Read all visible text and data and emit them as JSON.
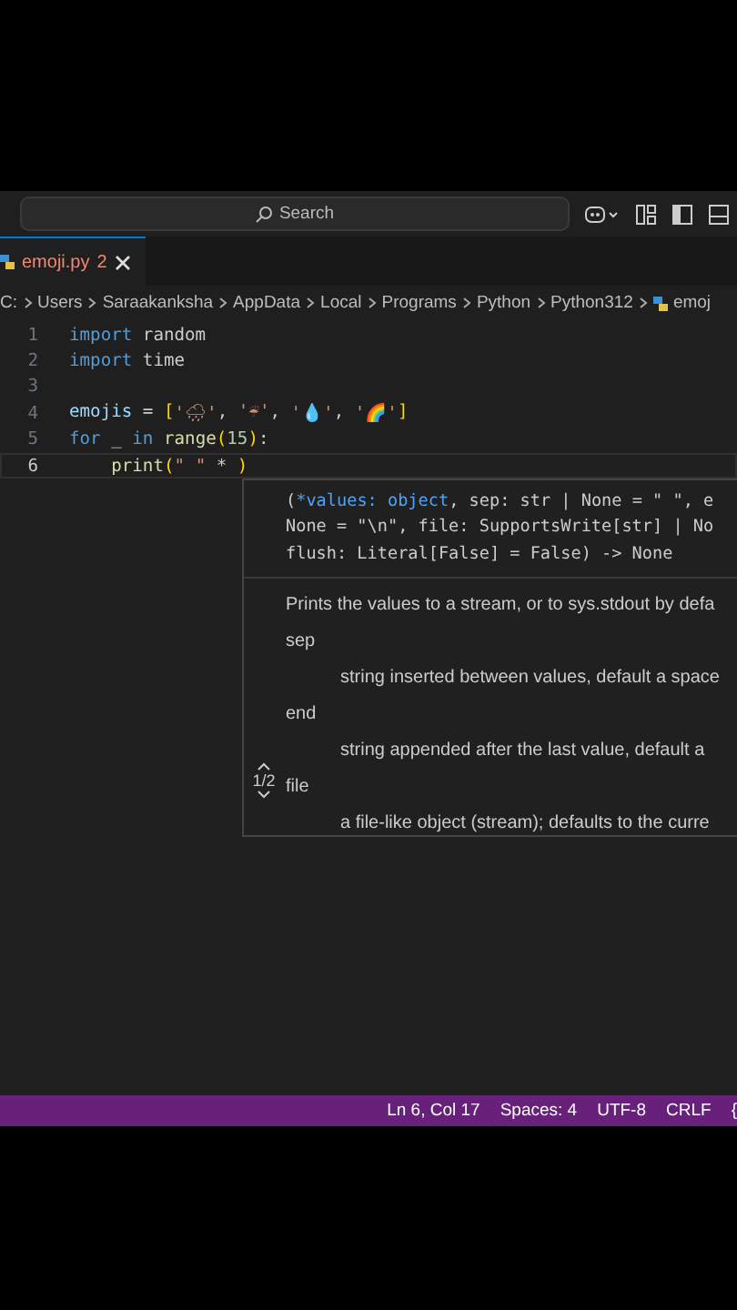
{
  "title_bar": {
    "search": {
      "placeholder": "Search"
    }
  },
  "tabs": [
    {
      "label": "emoji.py",
      "problems": "2",
      "selected": true
    }
  ],
  "breadcrumb": [
    "C:",
    "Users",
    "Saraakanksha",
    "AppData",
    "Local",
    "Programs",
    "Python",
    "Python312",
    "emoj"
  ],
  "editor": {
    "lines": [
      {
        "number": "1",
        "current": false,
        "tokens": [
          {
            "kind": "kw",
            "text": "import"
          },
          {
            "kind": "plain",
            "text": " random"
          }
        ]
      },
      {
        "number": "2",
        "current": false,
        "tokens": [
          {
            "kind": "kw",
            "text": "import"
          },
          {
            "kind": "plain",
            "text": " time"
          }
        ]
      },
      {
        "number": "3",
        "current": false
      },
      {
        "number": "4",
        "current": false,
        "tokens": [
          {
            "kind": "var",
            "text": "emojis"
          },
          {
            "kind": "plain",
            "text": " = "
          },
          {
            "kind": "bracket",
            "text": "["
          },
          {
            "kind": "str",
            "text": "'🌧'"
          },
          {
            "kind": "plain",
            "text": ", "
          },
          {
            "kind": "str",
            "text": "'☔'"
          },
          {
            "kind": "plain",
            "text": ", "
          },
          {
            "kind": "str",
            "text": "'💧'"
          },
          {
            "kind": "plain",
            "text": ", "
          },
          {
            "kind": "str",
            "text": "'🌈'"
          },
          {
            "kind": "bracket",
            "text": "]"
          }
        ]
      },
      {
        "number": "5",
        "current": false,
        "tokens": [
          {
            "kind": "kw",
            "text": "for"
          },
          {
            "kind": "plain",
            "text": " _ "
          },
          {
            "kind": "kw",
            "text": "in"
          },
          {
            "kind": "fn",
            "text": " range"
          },
          {
            "kind": "bracket",
            "text": "("
          },
          {
            "kind": "num",
            "text": "15"
          },
          {
            "kind": "bracket",
            "text": ")"
          },
          {
            "kind": "plain",
            "text": ":"
          }
        ]
      },
      {
        "number": "6",
        "current": true,
        "tokens": [
          {
            "kind": "fn",
            "text": "    print"
          },
          {
            "kind": "bracket",
            "text": "("
          },
          {
            "kind": "str",
            "text": "\" \""
          },
          {
            "kind": "plain",
            "text": " * "
          },
          {
            "kind": "bracket",
            "text": ")"
          }
        ]
      }
    ]
  },
  "hover": {
    "signature": [
      [
        {
          "kind": "punct",
          "text": "("
        },
        {
          "kind": "param",
          "text": "*values: object"
        },
        {
          "kind": "plain",
          "text": ", sep: str | None = \" \", e"
        }
      ],
      [
        {
          "kind": "plain",
          "text": "None = \"\\n\", file: SupportsWrite[str] | No"
        }
      ],
      [
        {
          "kind": "plain",
          "text": "flush: Literal[False] = False) -> None"
        }
      ]
    ],
    "description": "Prints the values to a stream, or to sys.stdout by defa",
    "params": [
      {
        "name": "sep",
        "doc": "string inserted between values, default a space"
      },
      {
        "name": "end",
        "doc": "string appended after the last value, default a"
      },
      {
        "name": "file",
        "doc": "a file-like object (stream); defaults to the curre"
      }
    ],
    "pager": "1/2"
  },
  "status_bar": [
    "Ln 6, Col 17",
    "Spaces: 4",
    "UTF-8",
    "CRLF",
    "{"
  ]
}
